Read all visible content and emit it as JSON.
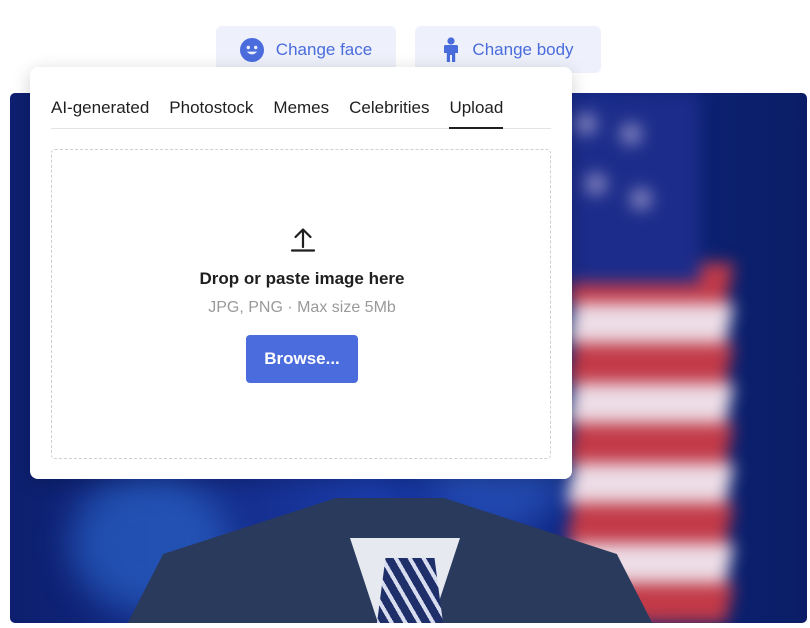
{
  "modes": {
    "change_face": "Change face",
    "change_body": "Change body"
  },
  "tabs": [
    "AI-generated",
    "Photostock",
    "Memes",
    "Celebrities",
    "Upload"
  ],
  "active_tab": "Upload",
  "dropzone": {
    "title": "Drop or paste image here",
    "hint": "JPG, PNG · Max size 5Mb",
    "browse_label": "Browse..."
  },
  "icons": {
    "face": "smiley-face-icon",
    "body": "person-icon",
    "upload": "upload-arrow-icon"
  },
  "colors": {
    "accent": "#4a6cdc",
    "button_bg": "#eef1fb",
    "text": "#1f1f1f",
    "muted": "#9a9a9a"
  }
}
